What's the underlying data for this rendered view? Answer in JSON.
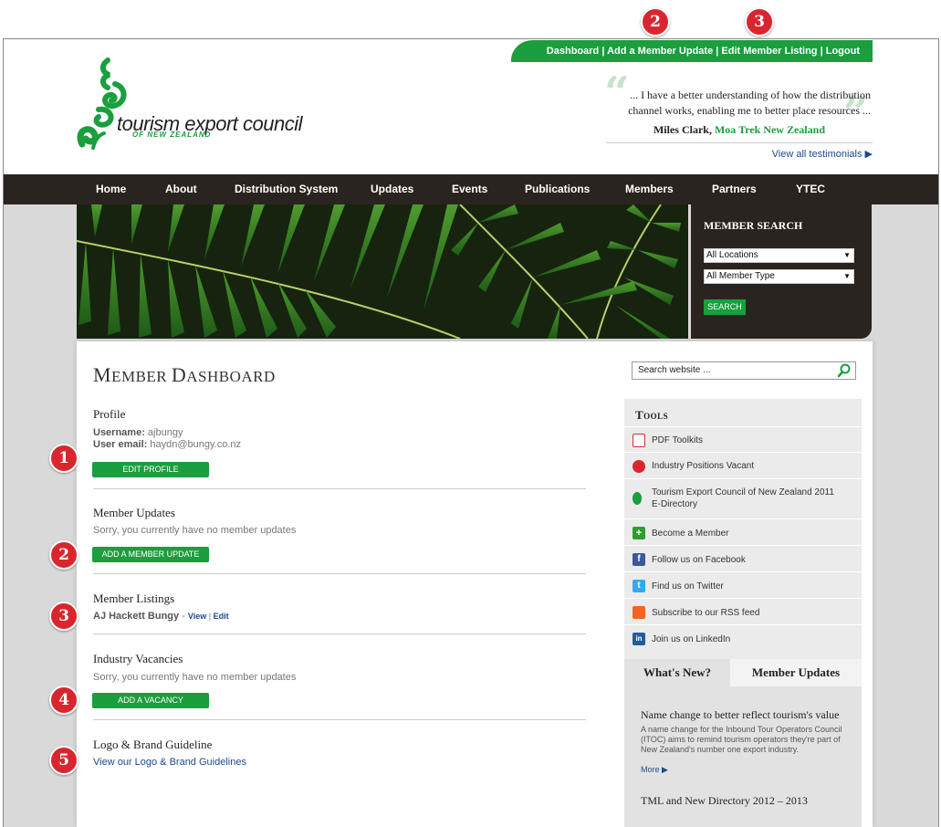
{
  "top_links": [
    "Dashboard",
    "Add a Member Update",
    "Edit Member Listing",
    "Logout"
  ],
  "top_separator": "|",
  "markers": [
    "1",
    "2",
    "3",
    "4",
    "5"
  ],
  "top_markers": [
    "2",
    "3"
  ],
  "logo": {
    "name": "tourism export council",
    "sub": "OF NEW ZEALAND"
  },
  "testimonial": {
    "line1": "... I have a better understanding of how the distribution",
    "line2": "channel works, enabling me to better place resources ...",
    "person": "Miles Clark,",
    "company": "Moa Trek New Zealand",
    "view_all": "View all testimonials ▶"
  },
  "nav": [
    "Home",
    "About",
    "Distribution System",
    "Updates",
    "Events",
    "Publications",
    "Members",
    "Partners",
    "YTEC"
  ],
  "member_search": {
    "title": "MEMBER SEARCH",
    "location": "All Locations",
    "type": "All Member Type",
    "button": "SEARCH"
  },
  "dashboard": {
    "title_cap1": "M",
    "title_rest1": "EMBER ",
    "title_cap2": "D",
    "title_rest2": "ASHBOARD",
    "profile": {
      "title": "Profile",
      "username_label": "Username:",
      "username": "ajbungy",
      "email_label": "User email:",
      "email": "haydn@bungy.co.nz",
      "button": "EDIT PROFILE"
    },
    "updates": {
      "title": "Member Updates",
      "text": "Sorry, you currently have no member updates",
      "button": "ADD A MEMBER UPDATE"
    },
    "listings": {
      "title": "Member Listings",
      "name": "AJ Hackett Bungy",
      "dash": " - ",
      "view": "View",
      "sep": " | ",
      "edit": "Edit"
    },
    "vacancies": {
      "title": "Industry Vacancies",
      "text": "Sorry, you currently have no member updates",
      "button": "ADD A VACANCY"
    },
    "brand": {
      "title": "Logo & Brand Guideline",
      "link": "View our Logo & Brand Guidelines"
    }
  },
  "site_search": {
    "placeholder": "Search website ..."
  },
  "tools": {
    "title": "Tools",
    "items": [
      {
        "label": "PDF Toolkits",
        "icon": "pdf-icon",
        "color": "#ffffff"
      },
      {
        "label": "Industry Positions Vacant",
        "icon": "acrobat-icon",
        "color": "#d9262e"
      },
      {
        "label": "Tourism Export Council of New Zealand 2011",
        "label2": "E-Directory",
        "icon": "tec-logo-icon",
        "color": "#1a9e3e"
      },
      {
        "label": "Become a Member",
        "icon": "plus-icon",
        "color": "#2f9e2f"
      },
      {
        "label": "Follow us on Facebook",
        "icon": "facebook-icon",
        "color": "#3b5998"
      },
      {
        "label": "Find us on Twitter",
        "icon": "twitter-icon",
        "color": "#33aaf0"
      },
      {
        "label": "Subscribe to our RSS feed",
        "icon": "rss-icon",
        "color": "#f26522"
      },
      {
        "label": "Join us on LinkedIn",
        "icon": "linkedin-icon",
        "color": "#1f5f9e"
      }
    ]
  },
  "news_tabs": {
    "tab1": "What's New?",
    "tab2": "Member Updates",
    "item1_title": "Name change to better reflect tourism's value",
    "item1_text": "A name change for the Inbound Tour Operators Council (ITOC) aims to remind tourism operators they're part of New Zealand's number one export industry.",
    "more": "More ▶",
    "item2_title": "TML and New Directory 2012 – 2013"
  },
  "colors": {
    "green": "#1a9e3e",
    "dark_nav": "#2a2420",
    "marker_red": "#d9262e",
    "link_blue": "#1c4a8f"
  }
}
